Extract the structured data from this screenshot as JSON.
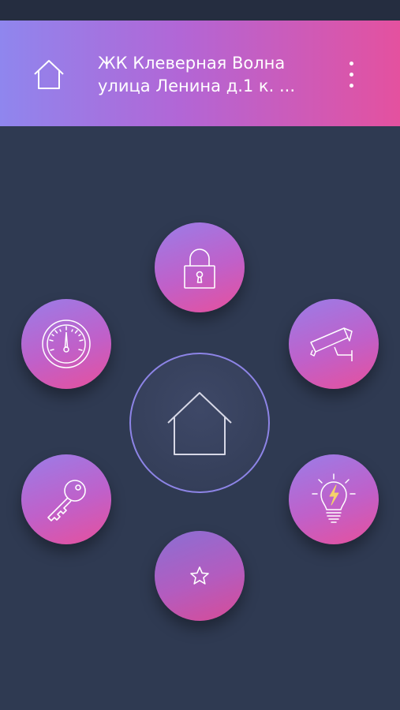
{
  "header": {
    "title_line1": "ЖК Клеверная Волна",
    "title_line2": "улица Ленина д.1 к. ..."
  },
  "tiles": [
    {
      "name": "lock-tile",
      "icon": "lock-icon"
    },
    {
      "name": "gauge-tile",
      "icon": "gauge-icon"
    },
    {
      "name": "camera-tile",
      "icon": "camera-icon"
    },
    {
      "name": "key-tile",
      "icon": "key-icon"
    },
    {
      "name": "lightbulb-tile",
      "icon": "lightbulb-icon"
    },
    {
      "name": "star-tile",
      "icon": "star-icon"
    }
  ],
  "center": {
    "icon": "home-icon"
  },
  "colors": {
    "background": "#2f3a52",
    "gradient_start": "#8f86ee",
    "gradient_end": "#e4519f",
    "ring": "#8d84e6"
  }
}
